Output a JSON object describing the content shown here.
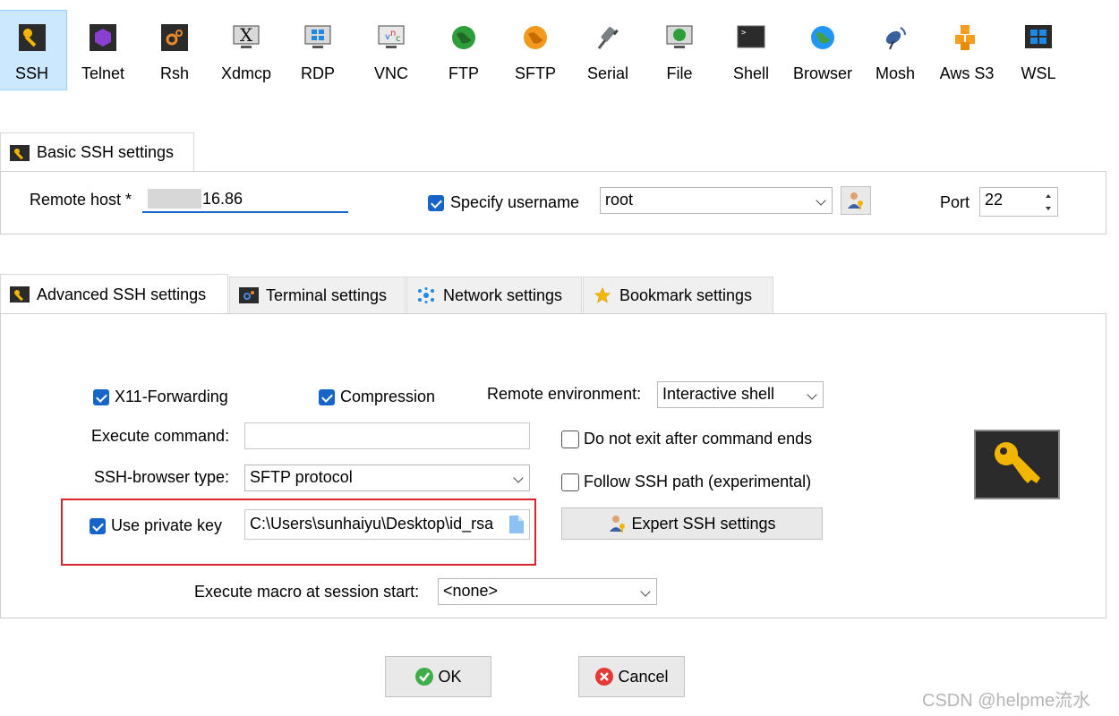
{
  "toolbar": {
    "items": [
      {
        "label": "SSH",
        "icon": "ssh-key-icon"
      },
      {
        "label": "Telnet",
        "icon": "telnet-icon"
      },
      {
        "label": "Rsh",
        "icon": "rsh-icon"
      },
      {
        "label": "Xdmcp",
        "icon": "xdmcp-icon"
      },
      {
        "label": "RDP",
        "icon": "rdp-icon"
      },
      {
        "label": "VNC",
        "icon": "vnc-icon"
      },
      {
        "label": "FTP",
        "icon": "ftp-globe-icon"
      },
      {
        "label": "SFTP",
        "icon": "sftp-globe-icon"
      },
      {
        "label": "Serial",
        "icon": "serial-plug-icon"
      },
      {
        "label": "File",
        "icon": "file-monitor-icon"
      },
      {
        "label": "Shell",
        "icon": "shell-terminal-icon"
      },
      {
        "label": "Browser",
        "icon": "browser-globe-icon"
      },
      {
        "label": "Mosh",
        "icon": "mosh-satellite-icon"
      },
      {
        "label": "Aws S3",
        "icon": "aws-s3-cubes-icon"
      },
      {
        "label": "WSL",
        "icon": "wsl-windows-icon"
      }
    ],
    "active": "SSH"
  },
  "basic": {
    "tab_label": "Basic SSH settings",
    "remote_host_label": "Remote host *",
    "remote_host_value": "16.86",
    "specify_username_label": "Specify username",
    "specify_username_checked": true,
    "username_value": "root",
    "port_label": "Port",
    "port_value": "22"
  },
  "tabs": [
    {
      "label": "Advanced SSH settings",
      "icon": "wrench-key-icon"
    },
    {
      "label": "Terminal settings",
      "icon": "terminal-gear-icon"
    },
    {
      "label": "Network settings",
      "icon": "network-nodes-icon"
    },
    {
      "label": "Bookmark settings",
      "icon": "star-icon"
    }
  ],
  "advanced": {
    "x11_label": "X11-Forwarding",
    "x11_checked": true,
    "compression_label": "Compression",
    "compression_checked": true,
    "remote_env_label": "Remote environment:",
    "remote_env_value": "Interactive shell",
    "execute_command_label": "Execute command:",
    "execute_command_value": "",
    "do_not_exit_label": "Do not exit after command ends",
    "do_not_exit_checked": false,
    "browser_type_label": "SSH-browser type:",
    "browser_type_value": "SFTP protocol",
    "follow_path_label": "Follow SSH path (experimental)",
    "follow_path_checked": false,
    "private_key_label": "Use private key",
    "private_key_checked": true,
    "private_key_value": "C:\\Users\\sunhaiyu\\Desktop\\id_rsa",
    "expert_button_label": "Expert SSH settings",
    "macro_label": "Execute macro at session start:",
    "macro_value": "<none>"
  },
  "dialog": {
    "ok_label": "OK",
    "cancel_label": "Cancel"
  },
  "watermark": "CSDN @helpme流水",
  "colors": {
    "accent_blue": "#1765c9",
    "active_tool_bg": "#cce8ff",
    "highlight_red": "#d9232e"
  }
}
